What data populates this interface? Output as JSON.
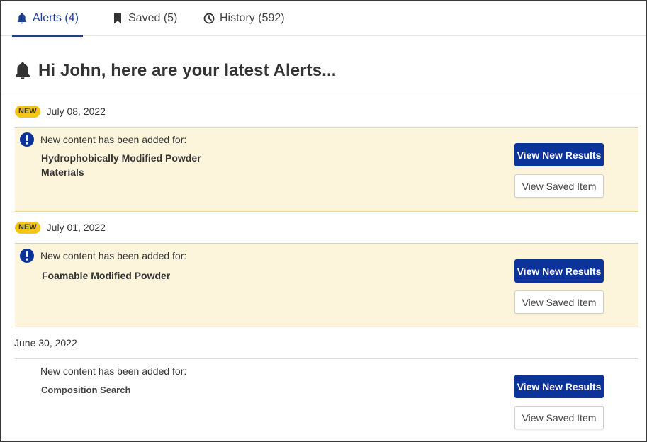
{
  "tabs": [
    {
      "label": "Alerts (4)",
      "icon": "bell-icon",
      "active": true
    },
    {
      "label": "Saved (5)",
      "icon": "bookmark-icon",
      "active": false
    },
    {
      "label": "History (592)",
      "icon": "clock-icon",
      "active": false
    }
  ],
  "heading": {
    "text": "Hi John, here are your latest Alerts...",
    "icon": "bell-icon"
  },
  "alerts": [
    {
      "badge": "NEW",
      "date": "July 08, 2022",
      "intro": "New content has been added for:",
      "topic": "Hydrophobically Modified Powder Materials",
      "primary_label": "View New Results",
      "secondary_label": "View Saved Item"
    },
    {
      "badge": "NEW",
      "date": "July 01, 2022",
      "intro": "New content has been added for:",
      "topic": "Foamable Modified Powder",
      "primary_label": "View New Results",
      "secondary_label": "View Saved Item"
    },
    {
      "badge": "",
      "date": "June 30, 2022",
      "intro": "New content has been added for:",
      "topic": "Composition Search",
      "primary_label": "View New Results",
      "secondary_label": "View Saved Item"
    }
  ],
  "colors": {
    "accent": "#1c3f94",
    "primary_button": "#0c3399",
    "badge": "#f5c518",
    "highlight_background": "#fcf5dc",
    "highlight_border": "#e8d68a"
  }
}
